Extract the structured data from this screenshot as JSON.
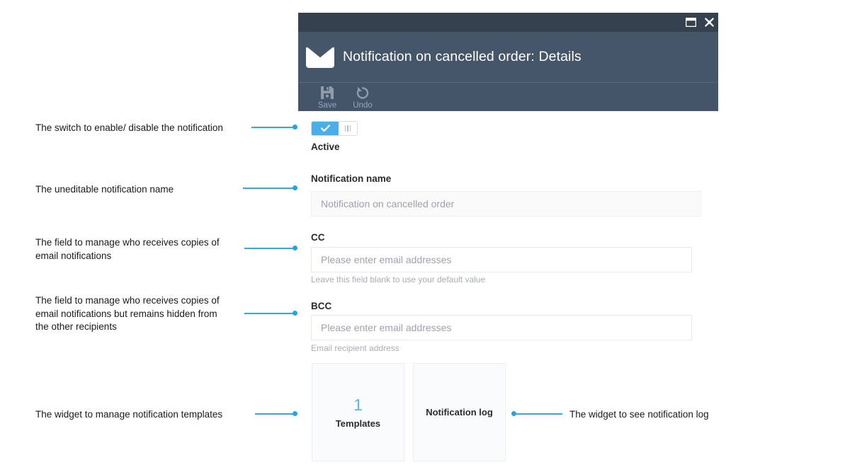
{
  "window": {
    "title": "Notification on cancelled order: Details",
    "icon": "envelope-icon",
    "controls": {
      "maximize": "maximize-icon",
      "close": "close-icon"
    },
    "toolbar": {
      "save_label": "Save",
      "undo_label": "Undo"
    }
  },
  "form": {
    "toggle": {
      "state": "on",
      "label": "Active"
    },
    "notification_name": {
      "label": "Notification name",
      "value": "Notification on cancelled order",
      "readonly": true
    },
    "cc": {
      "label": "CC",
      "placeholder": "Please enter email addresses",
      "value": "",
      "hint": "Leave this field blank to use your default value"
    },
    "bcc": {
      "label": "BCC",
      "placeholder": "Please enter email addresses",
      "value": "",
      "hint": "Email recipient address"
    }
  },
  "widgets": {
    "templates": {
      "count": "1",
      "caption": "Templates"
    },
    "notification_log": {
      "title": "Notification log"
    }
  },
  "annotations": {
    "switch": "The switch to enable/ disable the notification",
    "name": "The uneditable notification name",
    "cc": "The field to manage who receives copies of\nemail notifications",
    "bcc": "The field to manage who receives copies of\nemail notifications but remains hidden from\nthe other recipients",
    "templates": "The widget to manage notification templates",
    "log": "The widget to see notification log"
  },
  "colors": {
    "titlebar_top": "#35414f",
    "titlebar_main": "#455669",
    "toolbar": "#44556a",
    "accent": "#4aaee8",
    "leader": "#35a8e0"
  }
}
